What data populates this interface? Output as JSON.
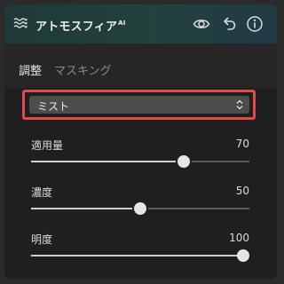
{
  "header": {
    "title": "アトモスフィア",
    "title_badge": "AI",
    "icons": [
      "waves-icon",
      "eye-icon",
      "undo-icon",
      "info-icon"
    ]
  },
  "tabs": [
    {
      "label": "調整",
      "active": true
    },
    {
      "label": "マスキング",
      "active": false
    }
  ],
  "preset": {
    "selected": "ミスト",
    "highlight_color": "#e04b4b"
  },
  "sliders": [
    {
      "label": "適用量",
      "value": "70",
      "fraction": 0.7
    },
    {
      "label": "濃度",
      "value": "50",
      "fraction": 0.5
    },
    {
      "label": "明度",
      "value": "100",
      "fraction": 1.0
    }
  ]
}
